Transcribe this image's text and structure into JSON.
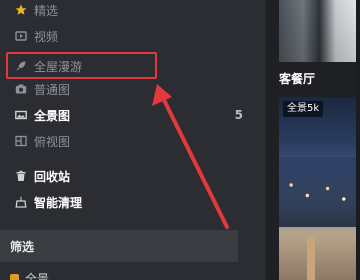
{
  "sidebar": {
    "items": [
      {
        "label": "精选",
        "icon": "star-icon"
      },
      {
        "label": "视频",
        "icon": "video-icon"
      },
      {
        "label": "全屋漫游",
        "icon": "rocket-icon"
      },
      {
        "label": "普通图",
        "icon": "camera-icon"
      },
      {
        "label": "全景图",
        "icon": "panorama-icon",
        "count": "5"
      },
      {
        "label": "俯视图",
        "icon": "topview-icon"
      },
      {
        "label": "回收站",
        "icon": "trash-icon"
      },
      {
        "label": "智能清理",
        "icon": "cleanup-icon"
      }
    ],
    "filter_label": "筛选",
    "partial_item": "全景"
  },
  "content": {
    "card1_title": "客餐厅",
    "card2_badge": "全景5k"
  },
  "colors": {
    "accent_red": "#e4393c",
    "star_gold": "#f0b323",
    "sidebar_bg": "#2b2d32"
  }
}
